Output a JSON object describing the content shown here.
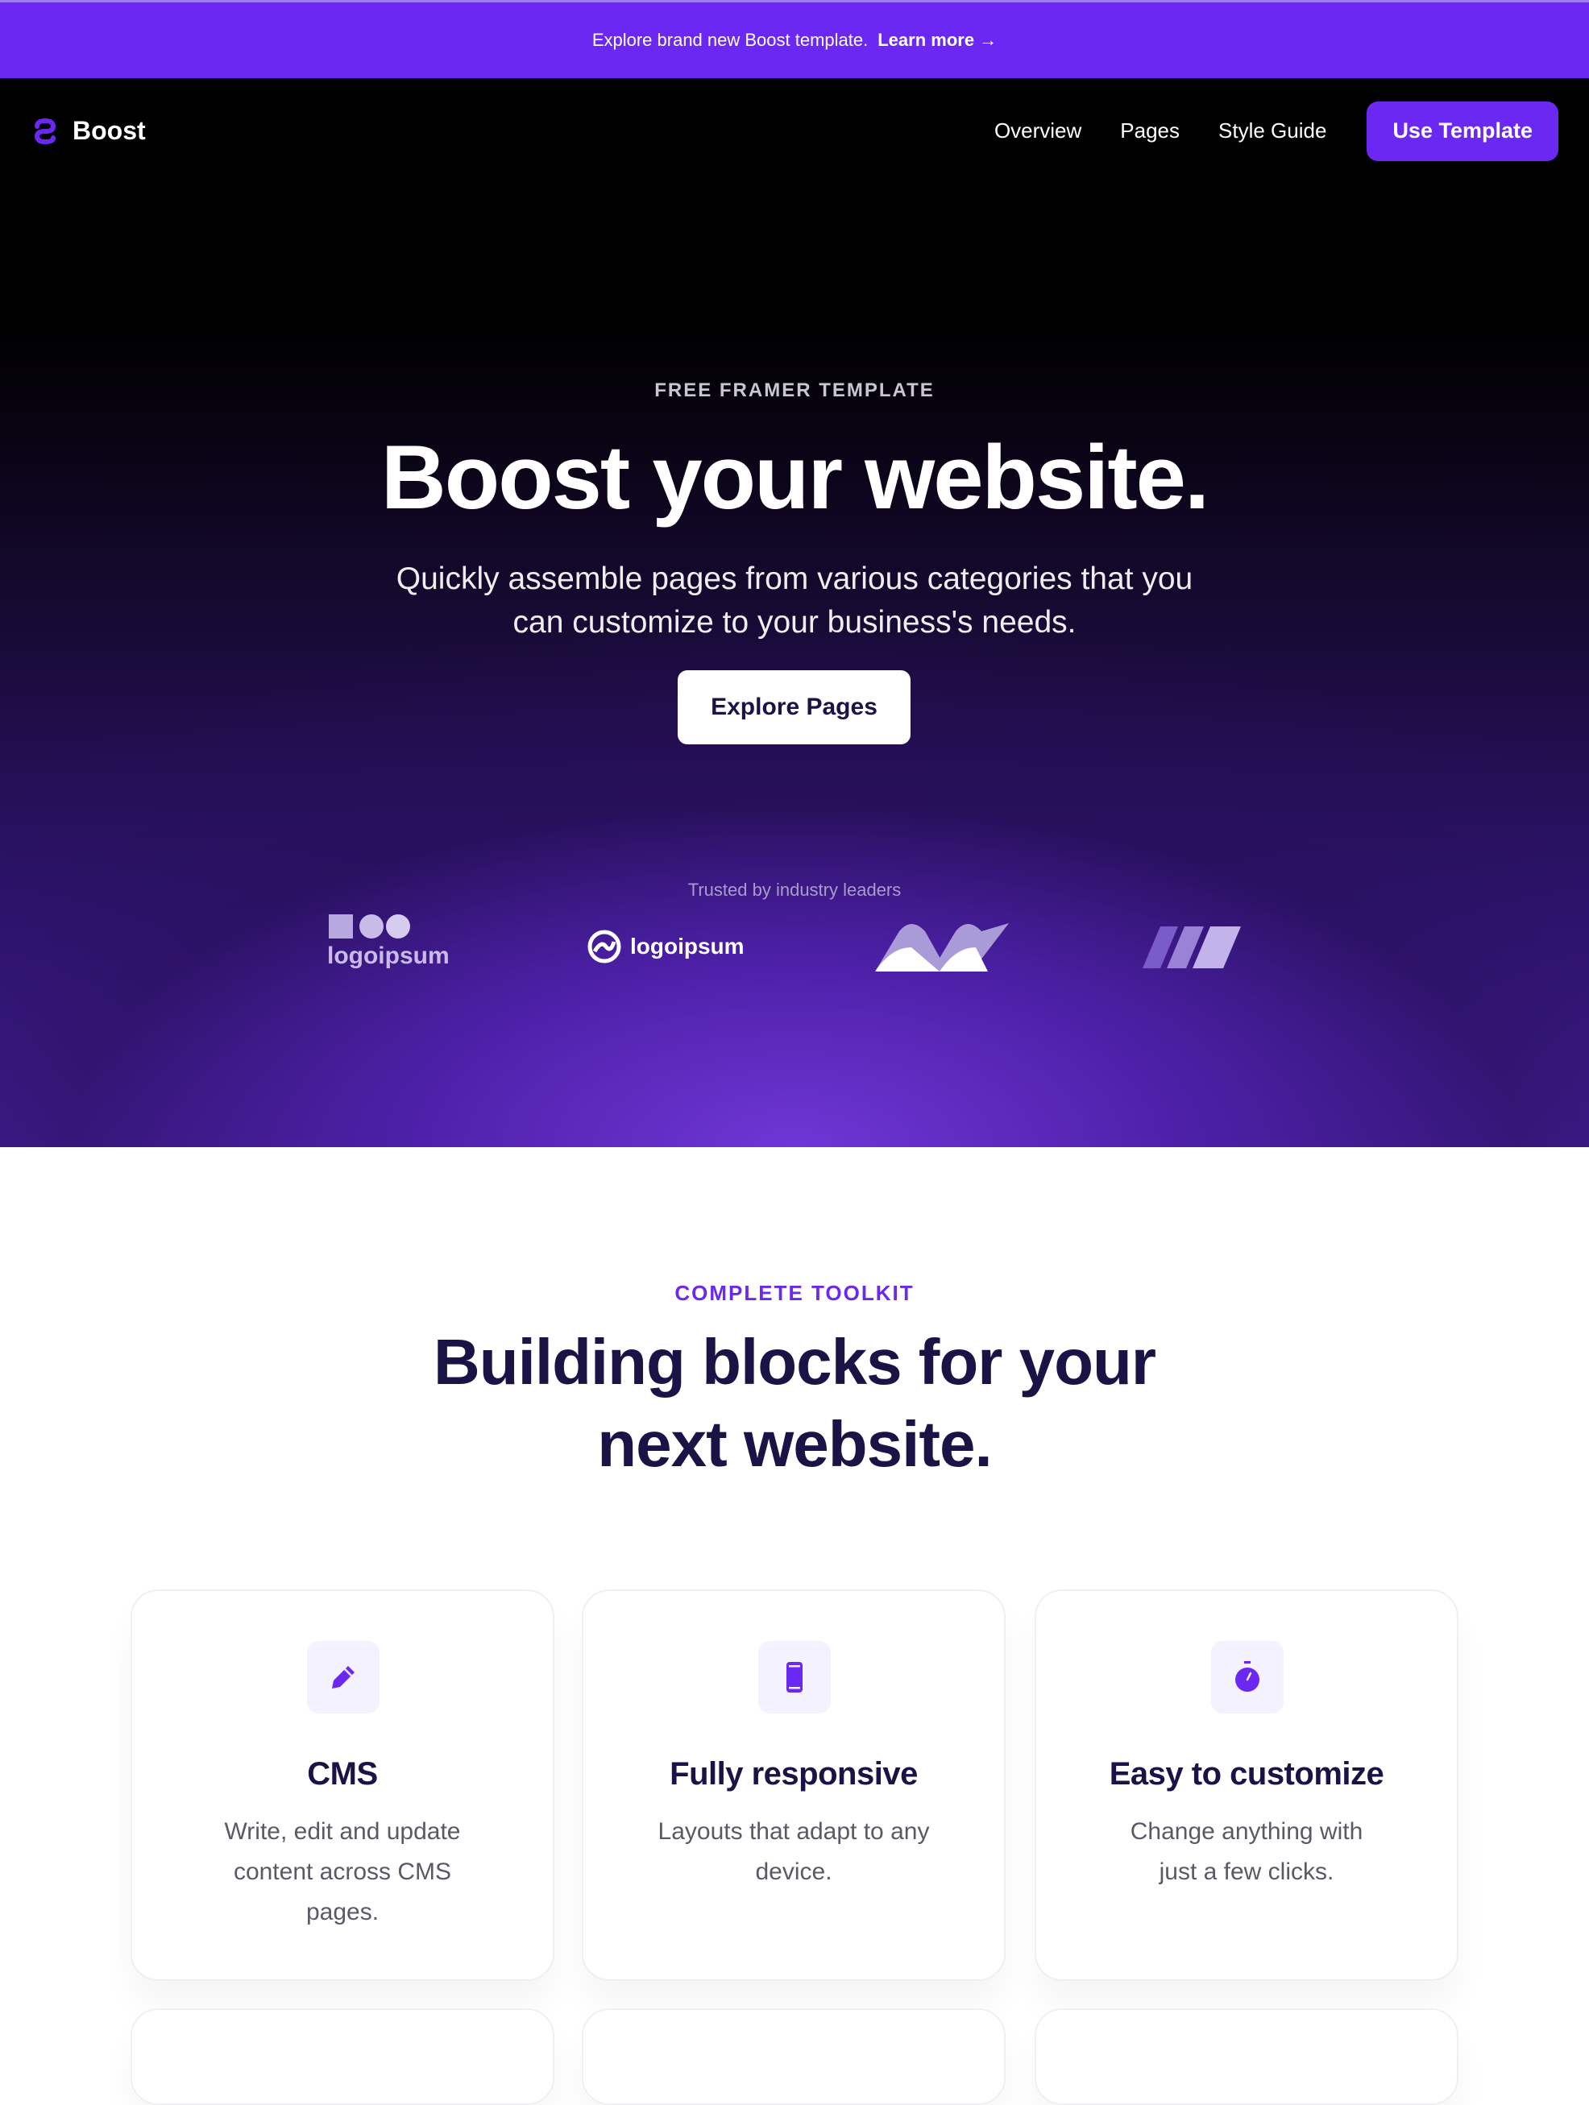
{
  "banner": {
    "text": "Explore brand new Boost template.",
    "link": "Learn more →"
  },
  "nav": {
    "brand": "Boost",
    "links": [
      "Overview",
      "Pages",
      "Style Guide"
    ],
    "cta": "Use Template"
  },
  "hero": {
    "eyebrow": "FREE FRAMER TEMPLATE",
    "title": "Boost your website.",
    "subtitle_line1": "Quickly assemble pages from various categories that you",
    "subtitle_line2": "can customize to your business's needs.",
    "button": "Explore Pages",
    "trusted": "Trusted by industry leaders",
    "logos": [
      "logoipsum",
      "logoipsum"
    ]
  },
  "toolkit": {
    "eyebrow": "COMPLETE TOOLKIT",
    "title_line1": "Building blocks for your",
    "title_line2": "next website.",
    "cards": [
      {
        "icon": "pencil-icon",
        "title": "CMS",
        "desc": "Write, edit and update content across CMS pages."
      },
      {
        "icon": "phone-icon",
        "title": "Fully responsive",
        "desc": "Layouts that adapt to any device."
      },
      {
        "icon": "stopwatch-icon",
        "title": "Easy to customize",
        "desc": "Change anything with just a few clicks."
      }
    ]
  },
  "colors": {
    "accent": "#6b28f2",
    "heading": "#1a1446"
  }
}
